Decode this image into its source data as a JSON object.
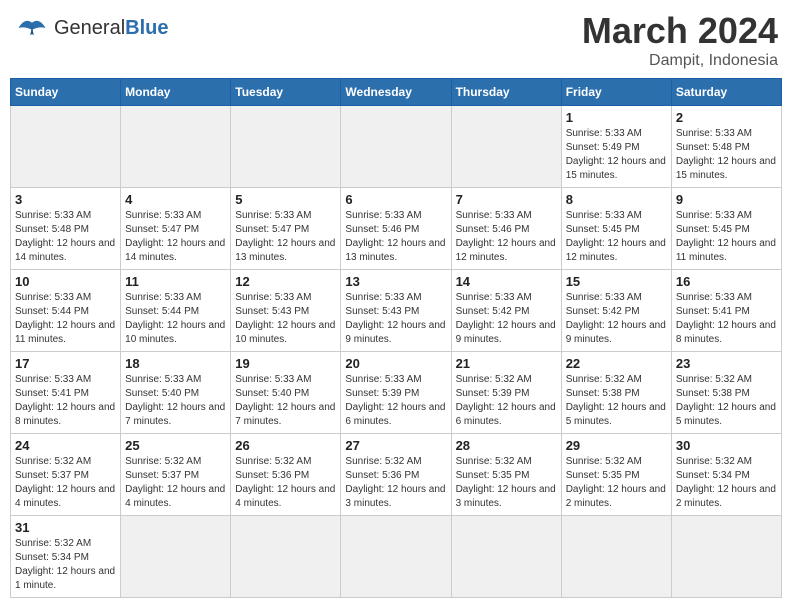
{
  "header": {
    "logo_general": "General",
    "logo_blue": "Blue",
    "month_year": "March 2024",
    "location": "Dampit, Indonesia"
  },
  "weekdays": [
    "Sunday",
    "Monday",
    "Tuesday",
    "Wednesday",
    "Thursday",
    "Friday",
    "Saturday"
  ],
  "weeks": [
    [
      {
        "day": "",
        "info": "",
        "empty": true
      },
      {
        "day": "",
        "info": "",
        "empty": true
      },
      {
        "day": "",
        "info": "",
        "empty": true
      },
      {
        "day": "",
        "info": "",
        "empty": true
      },
      {
        "day": "",
        "info": "",
        "empty": true
      },
      {
        "day": "1",
        "info": "Sunrise: 5:33 AM\nSunset: 5:49 PM\nDaylight: 12 hours and 15 minutes."
      },
      {
        "day": "2",
        "info": "Sunrise: 5:33 AM\nSunset: 5:48 PM\nDaylight: 12 hours and 15 minutes."
      }
    ],
    [
      {
        "day": "3",
        "info": "Sunrise: 5:33 AM\nSunset: 5:48 PM\nDaylight: 12 hours and 14 minutes."
      },
      {
        "day": "4",
        "info": "Sunrise: 5:33 AM\nSunset: 5:47 PM\nDaylight: 12 hours and 14 minutes."
      },
      {
        "day": "5",
        "info": "Sunrise: 5:33 AM\nSunset: 5:47 PM\nDaylight: 12 hours and 13 minutes."
      },
      {
        "day": "6",
        "info": "Sunrise: 5:33 AM\nSunset: 5:46 PM\nDaylight: 12 hours and 13 minutes."
      },
      {
        "day": "7",
        "info": "Sunrise: 5:33 AM\nSunset: 5:46 PM\nDaylight: 12 hours and 12 minutes."
      },
      {
        "day": "8",
        "info": "Sunrise: 5:33 AM\nSunset: 5:45 PM\nDaylight: 12 hours and 12 minutes."
      },
      {
        "day": "9",
        "info": "Sunrise: 5:33 AM\nSunset: 5:45 PM\nDaylight: 12 hours and 11 minutes."
      }
    ],
    [
      {
        "day": "10",
        "info": "Sunrise: 5:33 AM\nSunset: 5:44 PM\nDaylight: 12 hours and 11 minutes."
      },
      {
        "day": "11",
        "info": "Sunrise: 5:33 AM\nSunset: 5:44 PM\nDaylight: 12 hours and 10 minutes."
      },
      {
        "day": "12",
        "info": "Sunrise: 5:33 AM\nSunset: 5:43 PM\nDaylight: 12 hours and 10 minutes."
      },
      {
        "day": "13",
        "info": "Sunrise: 5:33 AM\nSunset: 5:43 PM\nDaylight: 12 hours and 9 minutes."
      },
      {
        "day": "14",
        "info": "Sunrise: 5:33 AM\nSunset: 5:42 PM\nDaylight: 12 hours and 9 minutes."
      },
      {
        "day": "15",
        "info": "Sunrise: 5:33 AM\nSunset: 5:42 PM\nDaylight: 12 hours and 9 minutes."
      },
      {
        "day": "16",
        "info": "Sunrise: 5:33 AM\nSunset: 5:41 PM\nDaylight: 12 hours and 8 minutes."
      }
    ],
    [
      {
        "day": "17",
        "info": "Sunrise: 5:33 AM\nSunset: 5:41 PM\nDaylight: 12 hours and 8 minutes."
      },
      {
        "day": "18",
        "info": "Sunrise: 5:33 AM\nSunset: 5:40 PM\nDaylight: 12 hours and 7 minutes."
      },
      {
        "day": "19",
        "info": "Sunrise: 5:33 AM\nSunset: 5:40 PM\nDaylight: 12 hours and 7 minutes."
      },
      {
        "day": "20",
        "info": "Sunrise: 5:33 AM\nSunset: 5:39 PM\nDaylight: 12 hours and 6 minutes."
      },
      {
        "day": "21",
        "info": "Sunrise: 5:32 AM\nSunset: 5:39 PM\nDaylight: 12 hours and 6 minutes."
      },
      {
        "day": "22",
        "info": "Sunrise: 5:32 AM\nSunset: 5:38 PM\nDaylight: 12 hours and 5 minutes."
      },
      {
        "day": "23",
        "info": "Sunrise: 5:32 AM\nSunset: 5:38 PM\nDaylight: 12 hours and 5 minutes."
      }
    ],
    [
      {
        "day": "24",
        "info": "Sunrise: 5:32 AM\nSunset: 5:37 PM\nDaylight: 12 hours and 4 minutes."
      },
      {
        "day": "25",
        "info": "Sunrise: 5:32 AM\nSunset: 5:37 PM\nDaylight: 12 hours and 4 minutes."
      },
      {
        "day": "26",
        "info": "Sunrise: 5:32 AM\nSunset: 5:36 PM\nDaylight: 12 hours and 4 minutes."
      },
      {
        "day": "27",
        "info": "Sunrise: 5:32 AM\nSunset: 5:36 PM\nDaylight: 12 hours and 3 minutes."
      },
      {
        "day": "28",
        "info": "Sunrise: 5:32 AM\nSunset: 5:35 PM\nDaylight: 12 hours and 3 minutes."
      },
      {
        "day": "29",
        "info": "Sunrise: 5:32 AM\nSunset: 5:35 PM\nDaylight: 12 hours and 2 minutes."
      },
      {
        "day": "30",
        "info": "Sunrise: 5:32 AM\nSunset: 5:34 PM\nDaylight: 12 hours and 2 minutes."
      }
    ],
    [
      {
        "day": "31",
        "info": "Sunrise: 5:32 AM\nSunset: 5:34 PM\nDaylight: 12 hours and 1 minute."
      },
      {
        "day": "",
        "info": "",
        "empty": true
      },
      {
        "day": "",
        "info": "",
        "empty": true
      },
      {
        "day": "",
        "info": "",
        "empty": true
      },
      {
        "day": "",
        "info": "",
        "empty": true
      },
      {
        "day": "",
        "info": "",
        "empty": true
      },
      {
        "day": "",
        "info": "",
        "empty": true
      }
    ]
  ]
}
